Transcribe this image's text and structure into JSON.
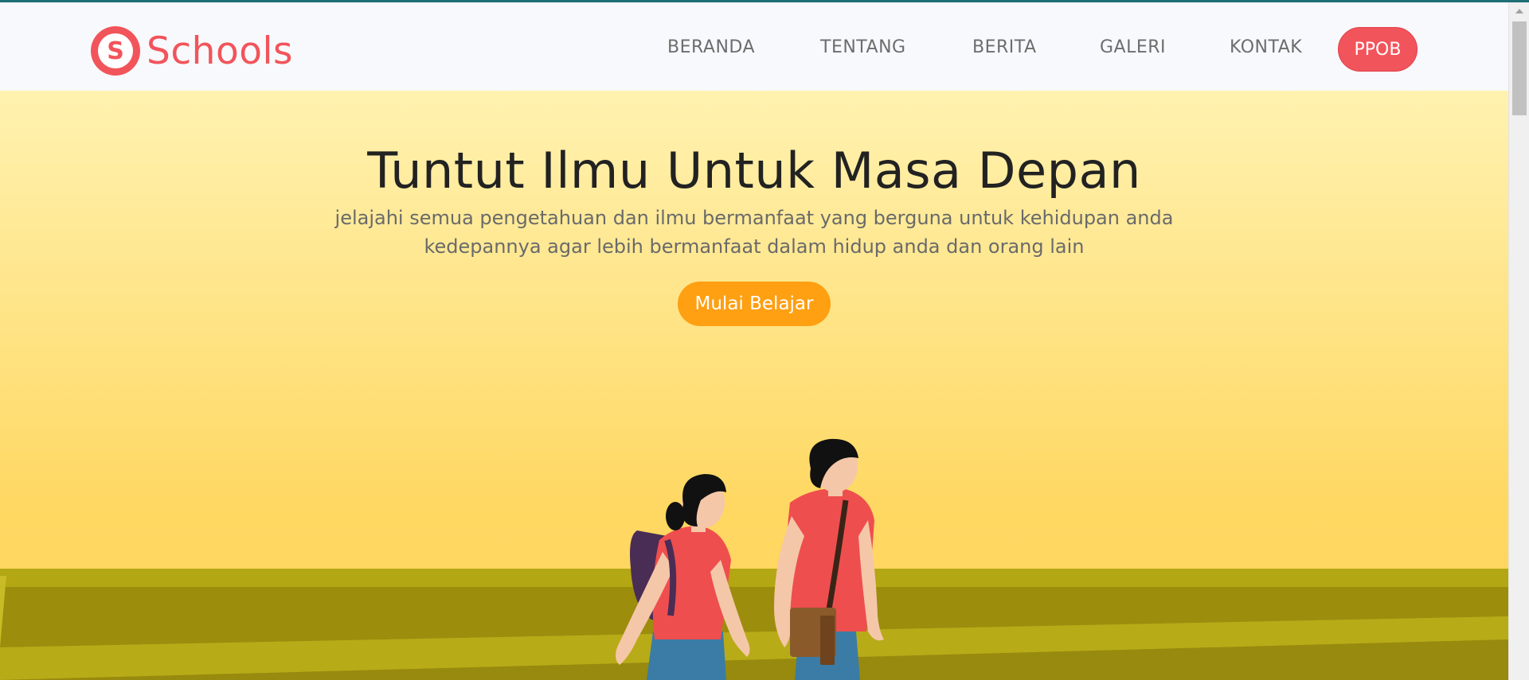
{
  "brand": {
    "logo_letter": "S",
    "name": "Schools"
  },
  "nav": {
    "items": [
      "BERANDA",
      "TENTANG",
      "BERITA",
      "GALERI",
      "KONTAK"
    ],
    "ppob_label": "PPOB"
  },
  "hero": {
    "title": "Tuntut Ilmu Untuk Masa Depan",
    "subtitle_line1": "jelajahi semua pengetahuan dan ilmu bermanfaat yang berguna untuk kehidupan anda",
    "subtitle_line2": "kedepannya agar lebih bermanfaat dalam hidup anda dan orang lain",
    "cta_label": "Mulai Belajar"
  },
  "colors": {
    "accent": "#f2545b",
    "cta": "#ff9f12",
    "top_line": "#1f6f76",
    "ground": "#b3a713"
  }
}
